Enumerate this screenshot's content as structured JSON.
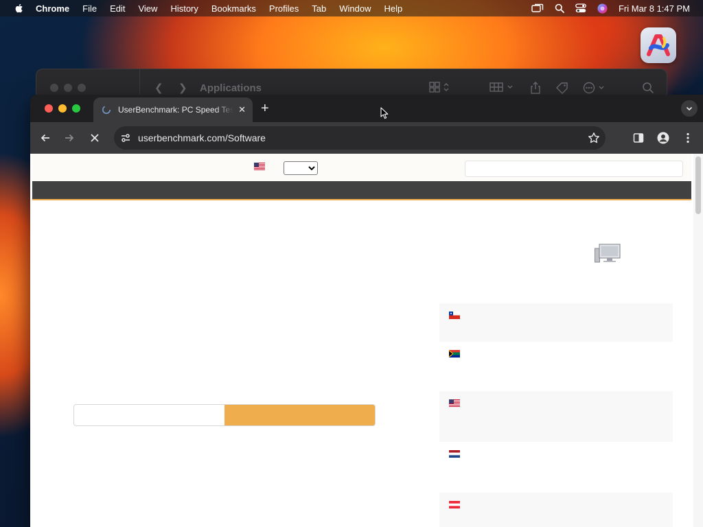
{
  "menubar": {
    "app_name": "Chrome",
    "items": [
      "File",
      "Edit",
      "View",
      "History",
      "Bookmarks",
      "Profiles",
      "Tab",
      "Window",
      "Help"
    ],
    "clock": "Fri Mar 8  1:47 PM"
  },
  "finder": {
    "title": "Applications"
  },
  "browser": {
    "tab": {
      "title": "UserBenchmark: PC Speed Test",
      "close_glyph": "✕"
    },
    "new_tab_glyph": "+",
    "address": "userbenchmark.com/Software",
    "loading": true
  },
  "page": {
    "language_select_value": "",
    "search_value": "",
    "progress": 0.5,
    "country_flags": [
      "chile-flag-icon",
      "south-africa-flag-icon",
      "usa-flag-icon",
      "netherlands-flag-icon",
      "austria-flag-icon"
    ]
  },
  "colors": {
    "accent": "#f0ad4e",
    "navbar": "#414141"
  }
}
